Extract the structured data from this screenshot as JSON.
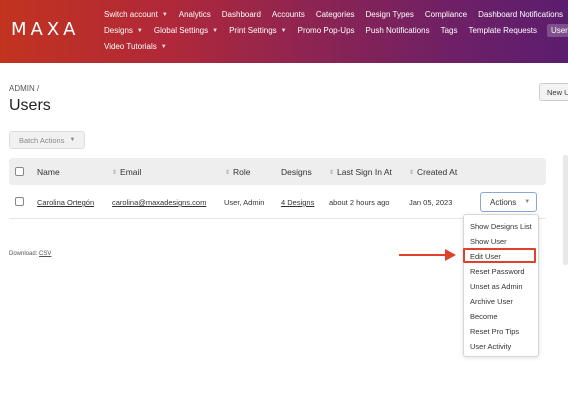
{
  "brand": {
    "logo_text": "MAXA"
  },
  "nav": {
    "row1": [
      {
        "label": "Switch account",
        "dropdown": true
      },
      {
        "label": "Analytics",
        "dropdown": false
      },
      {
        "label": "Dashboard",
        "dropdown": false
      },
      {
        "label": "Accounts",
        "dropdown": false
      },
      {
        "label": "Categories",
        "dropdown": false
      },
      {
        "label": "Design Types",
        "dropdown": false
      },
      {
        "label": "Compliance",
        "dropdown": false
      },
      {
        "label": "Dashboard Notifications",
        "dropdown": false
      }
    ],
    "row2": [
      {
        "label": "Designs",
        "dropdown": true
      },
      {
        "label": "Global Settings",
        "dropdown": true
      },
      {
        "label": "Print Settings",
        "dropdown": true
      },
      {
        "label": "Promo Pop-Ups",
        "dropdown": false
      },
      {
        "label": "Push Notifications",
        "dropdown": false
      },
      {
        "label": "Tags",
        "dropdown": false
      },
      {
        "label": "Template Requests",
        "dropdown": false
      },
      {
        "label": "Users",
        "dropdown": true,
        "active": true
      }
    ],
    "row3": [
      {
        "label": "Video Tutorials",
        "dropdown": true
      }
    ]
  },
  "breadcrumb": "ADMIN /",
  "page_title": "Users",
  "new_button_label": "New U",
  "batch_actions_label": "Batch Actions",
  "table": {
    "columns": [
      "Name",
      "Email",
      "Role",
      "Designs",
      "Last Sign In At",
      "Created At"
    ],
    "rows": [
      {
        "name": "Carolina Ortegón",
        "email": "carolina@maxadesigns.com",
        "role": "User, Admin",
        "designs": "4 Designs",
        "last_sign_in": "about 2 hours ago",
        "created_at": "Jan 05, 2023",
        "actions_label": "Actions"
      }
    ]
  },
  "download": {
    "prefix": "Download:",
    "csv": "CSV"
  },
  "actions_menu": {
    "items": [
      "Show Designs List",
      "Show User",
      "Edit User",
      "Reset Password",
      "Unset as Admin",
      "Archive User",
      "Become",
      "Reset Pro Tips",
      "User Activity"
    ],
    "highlighted": "Edit User"
  },
  "colors": {
    "header_gradient_start": "#c2331f",
    "header_gradient_end": "#5b1d6e",
    "annotation_red": "#e0412c",
    "actions_border": "#8aa8d6"
  },
  "icons": {
    "dropdown": "chevron-down-icon",
    "sort": "sort-icon",
    "annotation": "arrow-right-icon"
  }
}
